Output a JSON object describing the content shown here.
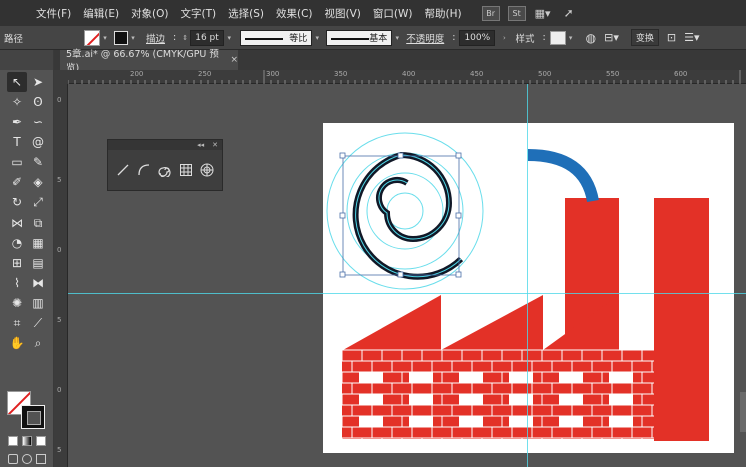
{
  "menubar": {
    "items": [
      "文件(F)",
      "编辑(E)",
      "对象(O)",
      "文字(T)",
      "选择(S)",
      "效果(C)",
      "视图(V)",
      "窗口(W)",
      "帮助(H)"
    ],
    "bridge_label": "Br",
    "stock_label": "St"
  },
  "control_bar": {
    "object_label": "路径",
    "stroke_label": "描边",
    "stroke_weight": "16 pt",
    "profile_label": "等比",
    "brush_label": "基本",
    "opacity_label": "不透明度",
    "opacity_value": "100%",
    "style_label": "样式",
    "transform_label": "变换"
  },
  "document_tab": {
    "title": "5章.ai* @ 66.67% (CMYK/GPU 预览)",
    "close": "×"
  },
  "ruler": {
    "top_ticks": [
      "200",
      "250",
      "300",
      "350",
      "400",
      "450",
      "500",
      "550",
      "600",
      "650"
    ],
    "left_ticks": [
      "0",
      "5",
      "0",
      "5",
      "0",
      "5"
    ]
  },
  "colors": {
    "accent_red": "#e33127",
    "pipe_blue": "#1f6fb8",
    "guide_cyan": "#4fd8e8",
    "ui_dark": "#323232",
    "ui_mid": "#535353"
  },
  "icons": {
    "float_panel": [
      "line-segment-icon",
      "arc-icon",
      "spiral-icon",
      "rectangular-grid-icon",
      "polar-grid-icon"
    ]
  }
}
